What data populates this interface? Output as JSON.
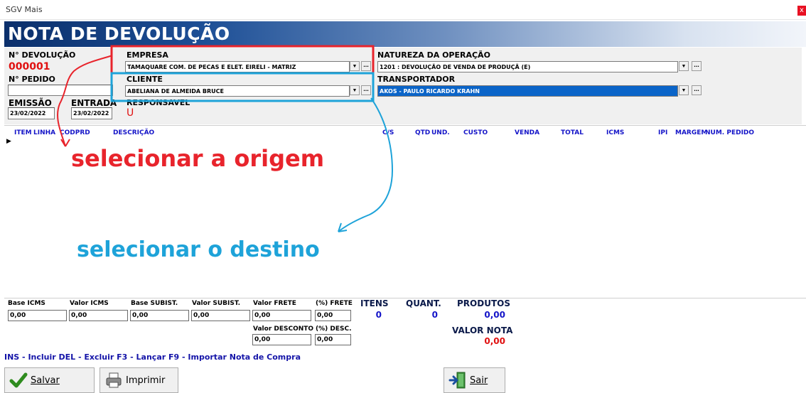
{
  "window": {
    "title": "SGV Mais",
    "close": "x"
  },
  "header": {
    "title": "NOTA DE DEVOLUÇÃO"
  },
  "form": {
    "n_devolucao_label": "N° DEVOLUÇÃO",
    "n_devolucao_value": "000001",
    "n_pedido_label": "N° PEDIDO",
    "n_pedido_value": "",
    "emissao_label": "EMISSÃO",
    "emissao_value": "23/02/2022",
    "entrada_label": "ENTRADA",
    "entrada_value": "23/02/2022",
    "empresa_label": "EMPRESA",
    "empresa_value": "TAMAQUARE COM. DE PECAS E ELET. EIRELI - MATRIZ",
    "cliente_label": "CLIENTE",
    "cliente_value": "ABELIANA DE ALMEIDA  BRUCE",
    "responsavel_label": "RESPONSAVEL",
    "responsavel_value": "U",
    "natureza_label": "NATUREZA DA OPERAÇÃO",
    "natureza_value": "1201 : DEVOLUÇÃO DE VENDA DE PRODUÇÃ (E)",
    "transportador_label": "TRANSPORTADOR",
    "transportador_value": "AKOS - PAULO RICARDO KRAHN",
    "dropdown_glyph": "▼",
    "ellipsis": "..."
  },
  "grid": {
    "columns": [
      "ITEM",
      "LINHA",
      "CODPRD",
      "DESCRIÇÃO",
      "C/S",
      "QTD",
      "UND.",
      "CUSTO",
      "VENDA",
      "TOTAL",
      "ICMS",
      "IPI",
      "MARGEM",
      "NUM. PEDIDO"
    ],
    "row_indicator": "▶"
  },
  "totals": {
    "base_icms_label": "Base ICMS",
    "base_icms": "0,00",
    "valor_icms_label": "Valor ICMS",
    "valor_icms": "0,00",
    "base_subist_label": "Base SUBIST.",
    "base_subist": "0,00",
    "valor_subist_label": "Valor SUBIST.",
    "valor_subist": "0,00",
    "valor_frete_label": "Valor FRETE",
    "valor_frete": "0,00",
    "pct_frete_label": "(%) FRETE",
    "pct_frete": "0,00",
    "valor_desconto_label": "Valor DESCONTO",
    "valor_desconto": "0,00",
    "pct_desc_label": "(%) DESC.",
    "pct_desc": "0,00",
    "itens_label": "ITENS",
    "itens": "0",
    "quant_label": "QUANT.",
    "quant": "0",
    "produtos_label": "PRODUTOS",
    "produtos": "0,00",
    "valor_nota_label": "VALOR NOTA",
    "valor_nota": "0,00"
  },
  "hints": "INS - Incluir   DEL - Excluir   F3 - Lançar   F9 - Importar Nota de Compra",
  "buttons": {
    "salvar": "Salvar",
    "imprimir": "Imprimir",
    "sair": "Sair"
  },
  "annotations": {
    "origem": "selecionar a origem",
    "destino": "selecionar o destino",
    "origem_color": "#e8242c",
    "destino_color": "#1ea3d9"
  }
}
